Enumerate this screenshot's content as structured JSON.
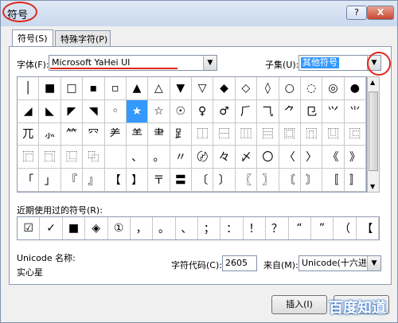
{
  "window": {
    "title": "符号",
    "help_label": "?",
    "close_label": "X"
  },
  "tabs": [
    {
      "label": "符号(S)"
    },
    {
      "label": "特殊字符(P)"
    }
  ],
  "font": {
    "label": "字体(F):",
    "value": "Microsoft YaHei UI"
  },
  "subset": {
    "label": "子集(U):",
    "value": "其他符号"
  },
  "symbols": [
    "│",
    "■",
    "□",
    "▪",
    "▫",
    "▲",
    "△",
    "▼",
    "▽",
    "◆",
    "◇",
    "◊",
    "○",
    "◌",
    "◎",
    "●",
    "◢",
    "◣",
    "◤",
    "◥",
    "◦",
    "★",
    "☆",
    "☉",
    "♀",
    "♂",
    "⺁",
    "⺄",
    "⺈",
    "⺋",
    "⺍",
    "⺌",
    "⺎",
    "⺗",
    "⺮",
    "⺳",
    "⺶",
    "⺷",
    "⺻",
    "⻊",
    "⿰",
    "⿱",
    "⿲",
    "⿳",
    "⿴",
    "⿵",
    "⿶",
    "⿷",
    "⿸",
    "⿹",
    "⿺",
    "⿻",
    "",
    "、",
    "。",
    "〃",
    "〄",
    "々",
    "〆",
    "〇",
    "〈",
    "〉",
    "《",
    "》",
    "「",
    "」",
    "『",
    "』",
    "【",
    "】",
    "〒",
    "〓",
    "〔",
    "〕",
    "〖",
    "〗",
    "〘",
    "〙",
    "〚",
    "〛"
  ],
  "recent": {
    "label": "近期使用过的符号(R):",
    "symbols": [
      "☑",
      "✓",
      "■",
      "◈",
      "①",
      "，",
      "。",
      "、",
      "；",
      "：",
      "！",
      "？",
      "“",
      "”",
      "（",
      "【"
    ]
  },
  "unicode": {
    "label": "Unicode 名称:",
    "name": "实心星"
  },
  "charcode": {
    "label": "字符代码(C):",
    "value": "2605"
  },
  "from": {
    "label": "来自(M):",
    "value": "Unicode(十六进"
  },
  "buttons": {
    "insert": "插入(I)"
  },
  "watermark": "百度知道",
  "colors": {
    "accent": "#3399ff",
    "annotation": "#e0281e"
  }
}
